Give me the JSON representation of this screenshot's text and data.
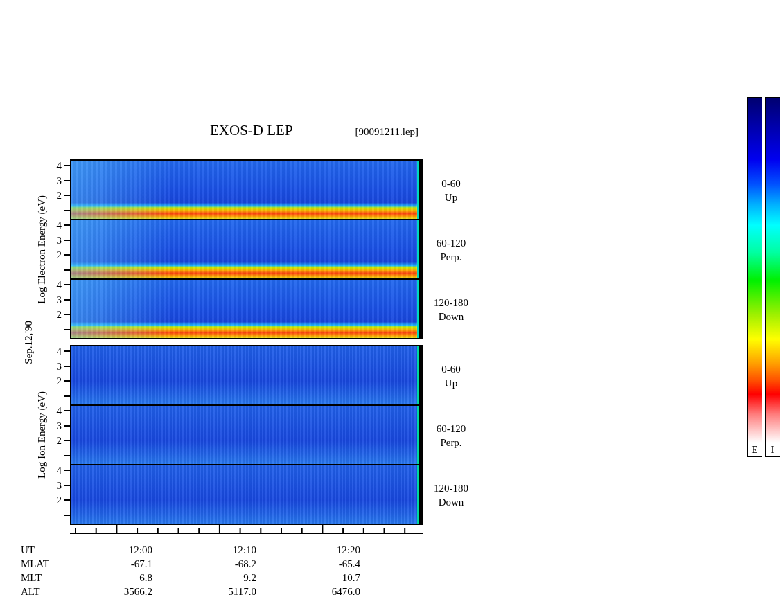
{
  "title": "EXOS-D LEP",
  "file": "[90091211.lep]",
  "date": "Sep.12,'90",
  "groups": [
    {
      "kind": "electron",
      "axis_label": "Log Electron Energy (eV)",
      "panels": [
        {
          "label": "0-60",
          "sublabel": "Up",
          "ticks": [
            "4",
            "3",
            "2"
          ]
        },
        {
          "label": "60-120",
          "sublabel": "Perp.",
          "ticks": [
            "4",
            "3",
            "2"
          ]
        },
        {
          "label": "120-180",
          "sublabel": "Down",
          "ticks": [
            "4",
            "3",
            "2"
          ]
        }
      ]
    },
    {
      "kind": "ion",
      "axis_label": "Log Ion Energy (eV)",
      "panels": [
        {
          "label": "0-60",
          "sublabel": "Up",
          "ticks": [
            "4",
            "3",
            "2"
          ]
        },
        {
          "label": "60-120",
          "sublabel": "Perp.",
          "ticks": [
            "4",
            "3",
            "2"
          ]
        },
        {
          "label": "120-180",
          "sublabel": "Down",
          "ticks": [
            "4",
            "3",
            "2"
          ]
        }
      ]
    }
  ],
  "orbit_table": [
    {
      "label": "UT",
      "values": [
        "12:00",
        "12:10",
        "12:20"
      ]
    },
    {
      "label": "MLAT",
      "values": [
        "-67.1",
        "-68.2",
        "-65.4"
      ]
    },
    {
      "label": "MLT",
      "values": [
        "6.8",
        "9.2",
        "10.7"
      ]
    },
    {
      "label": "ALT",
      "values": [
        "3566.2",
        "5117.0",
        "6476.0"
      ]
    }
  ],
  "colorbars": [
    {
      "label": "E"
    },
    {
      "label": "I"
    }
  ]
}
